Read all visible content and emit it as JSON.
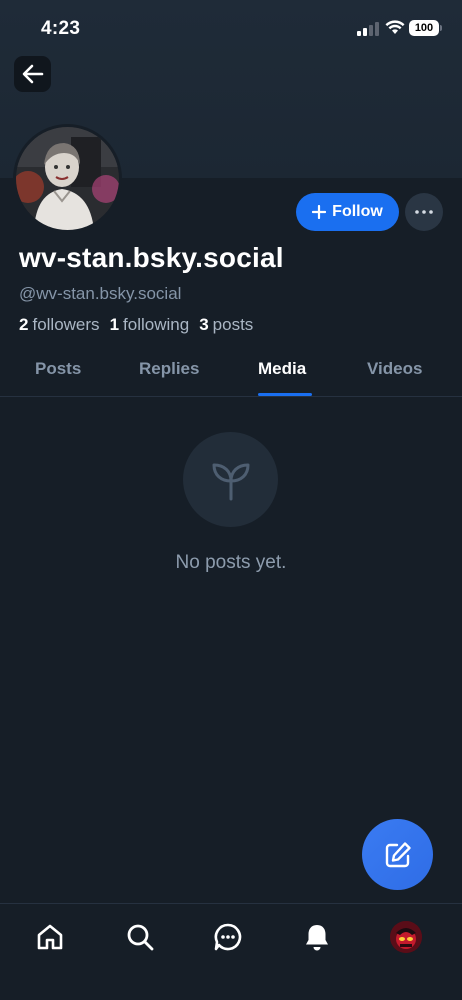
{
  "status_bar": {
    "time": "4:23",
    "battery": "100"
  },
  "profile": {
    "display_name": "wv-stan.bsky.social",
    "handle": "@wv-stan.bsky.social",
    "followers_count": "2",
    "followers_label": "followers",
    "following_count": "1",
    "following_label": "following",
    "posts_count": "3",
    "posts_label": "posts"
  },
  "actions": {
    "follow_label": "Follow"
  },
  "tabs": [
    {
      "label": "Posts",
      "active": false
    },
    {
      "label": "Replies",
      "active": false
    },
    {
      "label": "Media",
      "active": true
    },
    {
      "label": "Videos",
      "active": false
    }
  ],
  "empty_state": {
    "icon": "sprout-icon",
    "message": "No posts yet."
  },
  "bottom_nav": [
    {
      "icon": "home-icon"
    },
    {
      "icon": "search-icon"
    },
    {
      "icon": "chat-icon"
    },
    {
      "icon": "bell-icon"
    },
    {
      "icon": "profile-avatar"
    }
  ],
  "colors": {
    "background": "#161e27",
    "accent": "#1a6ff0",
    "muted_text": "#8595a8"
  }
}
